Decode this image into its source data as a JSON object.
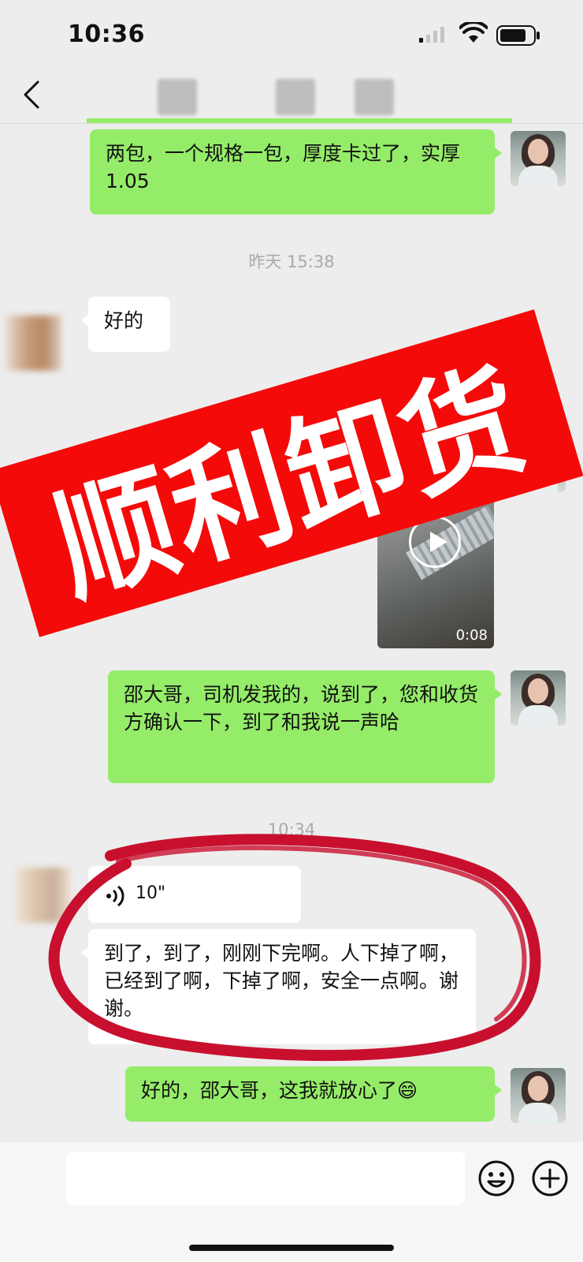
{
  "status_bar": {
    "time": "10:36"
  },
  "messages": [
    {
      "text": "两包，一个规格一包，厚度卡过了，实厚1.05"
    },
    {
      "text": "好的"
    },
    {
      "text": "邵大哥，司机发我的，说到了，您和收货方确认一下，到了和我说一声哈"
    },
    {
      "text": "到了，到了，刚刚下完啊。人下掉了啊，已经到了啊，下掉了啊，安全一点啊。谢谢。"
    },
    {
      "text": "好的，邵大哥，这我就放心了😄"
    }
  ],
  "timestamps": [
    "昨天 15:38",
    "10:34"
  ],
  "video": {
    "duration": "0:08"
  },
  "voice": {
    "duration": "10\""
  },
  "banner": {
    "text": "顺利卸货"
  },
  "colors": {
    "green_bubble": "#95ec69",
    "banner_red": "#f50a0a",
    "circle_red": "#c8102e",
    "background": "#ededed"
  },
  "icons": [
    "back-arrow-icon",
    "signal-icon",
    "wifi-icon",
    "battery-icon",
    "play-icon",
    "voice-wave-icon",
    "emoji-icon",
    "plus-icon"
  ]
}
